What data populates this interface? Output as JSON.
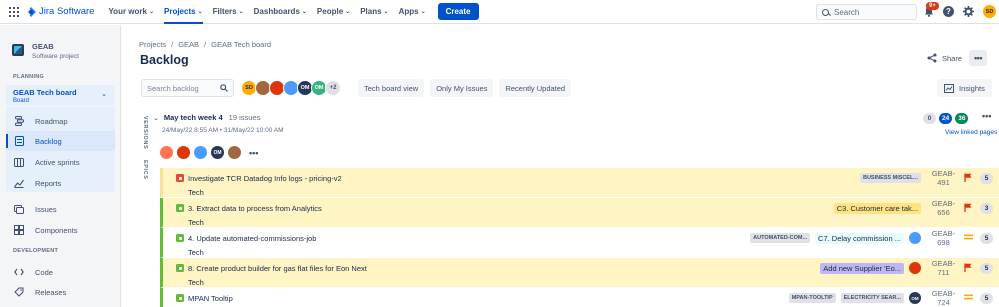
{
  "app": {
    "name": "Jira Software"
  },
  "nav": {
    "items": [
      {
        "label": "Your work",
        "active": false
      },
      {
        "label": "Projects",
        "active": true
      },
      {
        "label": "Filters",
        "active": false
      },
      {
        "label": "Dashboards",
        "active": false
      },
      {
        "label": "People",
        "active": false
      },
      {
        "label": "Plans",
        "active": false
      },
      {
        "label": "Apps",
        "active": false
      }
    ],
    "create_label": "Create",
    "search_placeholder": "Search",
    "notification_count": "9+",
    "user_initials": "SD"
  },
  "sidebar": {
    "project_name": "GEAB",
    "project_type": "Software project",
    "planning_title": "PLANNING",
    "board_title": "GEAB Tech board",
    "board_sub": "Board",
    "items": [
      {
        "label": "Roadmap",
        "icon": "roadmap-icon"
      },
      {
        "label": "Backlog",
        "icon": "backlog-icon",
        "active": true
      },
      {
        "label": "Active sprints",
        "icon": "sprints-icon"
      },
      {
        "label": "Reports",
        "icon": "reports-icon"
      },
      {
        "label": "Issues",
        "icon": "issues-icon"
      },
      {
        "label": "Components",
        "icon": "components-icon"
      }
    ],
    "development_title": "DEVELOPMENT",
    "dev_items": [
      {
        "label": "Code",
        "icon": "code-icon"
      },
      {
        "label": "Releases",
        "icon": "releases-icon"
      }
    ]
  },
  "breadcrumb": [
    "Projects",
    "GEAB",
    "GEAB Tech board"
  ],
  "page": {
    "title": "Backlog",
    "share_label": "Share",
    "more_label": "•••"
  },
  "toolbar": {
    "search_placeholder": "Search backlog",
    "extra_avatars": "+2",
    "view_label": "Tech board view",
    "only_my_issues": "Only My Issues",
    "recently_updated": "Recently Updated",
    "insights_label": "Insights",
    "avatars": [
      {
        "initials": "SD",
        "color": "#ffab00"
      },
      {
        "initials": "",
        "color": "#a5673f"
      },
      {
        "initials": "",
        "color": "#de350b"
      },
      {
        "initials": "",
        "color": "#4c9aff"
      },
      {
        "initials": "OM",
        "color": "#253858"
      },
      {
        "initials": "OM",
        "color": "#36b37e"
      }
    ]
  },
  "labels": {
    "versions": "VERSIONS",
    "epics": "EPICS"
  },
  "sprint": {
    "name": "May tech week 4",
    "issue_count": "19 issues",
    "dates": "24/May/22 8:55 AM • 31/May/22 10:00 AM",
    "todo": "0",
    "in_progress": "24",
    "done": "36",
    "linked_pages": "View linked pages",
    "avatars": [
      {
        "initials": "",
        "color": "#ff7452"
      },
      {
        "initials": "",
        "color": "#de350b"
      },
      {
        "initials": "",
        "color": "#4c9aff"
      },
      {
        "initials": "OM",
        "color": "#253858"
      },
      {
        "initials": "",
        "color": "#a5673f"
      }
    ],
    "more_label": "•••"
  },
  "issues": [
    {
      "summary": "Investigate TCR Datadog Info logs - pricing-v2",
      "epic": "Tech",
      "type": "bug",
      "type_color": "#e5493a",
      "bg": "#fff4c4",
      "border": "#f4e39b",
      "lozenges": [
        "BUSINESS MISCEL..."
      ],
      "epic_label": "",
      "epic_label_bg": "",
      "assignee": "",
      "assignee_color": "",
      "key": "GEAB-491",
      "priority": "highest",
      "estimate": "5"
    },
    {
      "summary": "3. Extract data to process from Analytics",
      "epic": "Tech",
      "type": "story",
      "type_color": "#63ba3c",
      "bg": "#fff4c4",
      "border": "#63ba3c",
      "lozenges": [],
      "epic_label": "C3. Customer care tak...",
      "epic_label_bg": "#ffe380",
      "assignee": "",
      "assignee_color": "",
      "key": "GEAB-656",
      "priority": "highest",
      "estimate": "3"
    },
    {
      "summary": "4. Update automated-commissions-job",
      "epic": "Tech",
      "type": "story",
      "type_color": "#63ba3c",
      "bg": "#ffffff",
      "border": "#63ba3c",
      "lozenges": [
        "AUTOMATED-COM..."
      ],
      "epic_label": "C7. Delay commission ...",
      "epic_label_bg": "#e6fcff",
      "assignee": "",
      "assignee_color": "#4c9aff",
      "key": "GEAB-698",
      "priority": "medium",
      "estimate": "5"
    },
    {
      "summary": "8. Create product builder for gas flat files for Eon Next",
      "epic": "Tech",
      "type": "story",
      "type_color": "#63ba3c",
      "bg": "#fff4c4",
      "border": "#63ba3c",
      "lozenges": [],
      "epic_label": "Add new Supplier 'Eo...",
      "epic_label_bg": "#c0b6f2",
      "assignee": "",
      "assignee_color": "#de350b",
      "key": "GEAB-711",
      "priority": "highest",
      "estimate": "5"
    },
    {
      "summary": "MPAN Tooltip",
      "epic": "",
      "type": "story",
      "type_color": "#63ba3c",
      "bg": "#ffffff",
      "border": "#63ba3c",
      "lozenges": [
        "MPAN-TOOLTIP",
        "ELECTRICITY SEAR..."
      ],
      "epic_label": "",
      "epic_label_bg": "",
      "assignee": "OM",
      "assignee_color": "#253858",
      "key": "GEAB-724",
      "priority": "medium",
      "estimate": "5"
    }
  ],
  "colors": {
    "accent": "#0052cc",
    "highlight": "#fff4c4"
  }
}
